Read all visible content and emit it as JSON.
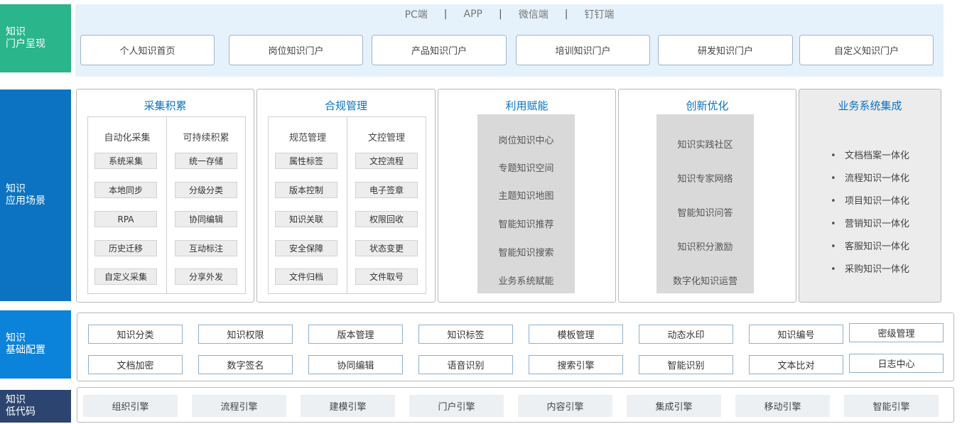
{
  "rows": {
    "portal": {
      "label_line1": "知识",
      "label_line2": "门户呈现"
    },
    "scenario": {
      "label_line1": "知识",
      "label_line2": "应用场景"
    },
    "config": {
      "label_line1": "知识",
      "label_line2": "基础配置"
    },
    "lowcode": {
      "label_line1": "知识",
      "label_line2": "低代码"
    }
  },
  "channels": [
    "PC端",
    "APP",
    "微信端",
    "钉钉端"
  ],
  "channel_separator": "|",
  "portals": [
    "个人知识首页",
    "岗位知识门户",
    "产品知识门户",
    "培训知识门户",
    "研发知识门户",
    "自定义知识门户"
  ],
  "panels": {
    "collect": {
      "title": "采集积累",
      "col1": {
        "head": "自动化采集",
        "items": [
          "系统采集",
          "本地同步",
          "RPA",
          "历史迁移",
          "自定义采集"
        ]
      },
      "col2": {
        "head": "可持续积累",
        "items": [
          "统一存储",
          "分级分类",
          "协同编辑",
          "互动标注",
          "分享外发"
        ]
      }
    },
    "compliance": {
      "title": "合规管理",
      "col1": {
        "head": "规范管理",
        "items": [
          "属性标签",
          "版本控制",
          "知识关联",
          "安全保障",
          "文件归档"
        ]
      },
      "col2": {
        "head": "文控管理",
        "items": [
          "文控流程",
          "电子签章",
          "权限回收",
          "状态变更",
          "文件取号"
        ]
      }
    },
    "utilize": {
      "title": "利用赋能",
      "items": [
        "岗位知识中心",
        "专题知识空间",
        "主题知识地图",
        "智能知识推荐",
        "智能知识搜索",
        "业务系统赋能"
      ]
    },
    "innovate": {
      "title": "创新优化",
      "items": [
        "知识实践社区",
        "知识专家网络",
        "智能知识问答",
        "知识积分激励",
        "数字化知识运营"
      ]
    },
    "integration": {
      "title": "业务系统集成",
      "bullet": "•",
      "items": [
        "文档档案一体化",
        "流程知识一体化",
        "项目知识一体化",
        "营销知识一体化",
        "客服知识一体化",
        "采购知识一体化"
      ]
    }
  },
  "config_row1": [
    "知识分类",
    "知识权限",
    "版本管理",
    "知识标签",
    "模板管理",
    "动态水印",
    "知识编号",
    "密级管理"
  ],
  "config_row2": [
    "文档加密",
    "数字签名",
    "协同编辑",
    "语音识别",
    "搜索引擎",
    "智能识别",
    "文本比对",
    "日志中心"
  ],
  "lowcode": [
    "组织引擎",
    "流程引擎",
    "建模引擎",
    "门户引擎",
    "内容引擎",
    "集成引擎",
    "移动引擎",
    "智能引擎"
  ],
  "colors": {
    "portal_label": "#2ab58a",
    "scenario_label": "#0b73c2",
    "config_label": "#0b83da",
    "lowcode_label": "#2c4570",
    "portal_background": "#e6f2fb",
    "panel_title": "#0b73c2"
  }
}
